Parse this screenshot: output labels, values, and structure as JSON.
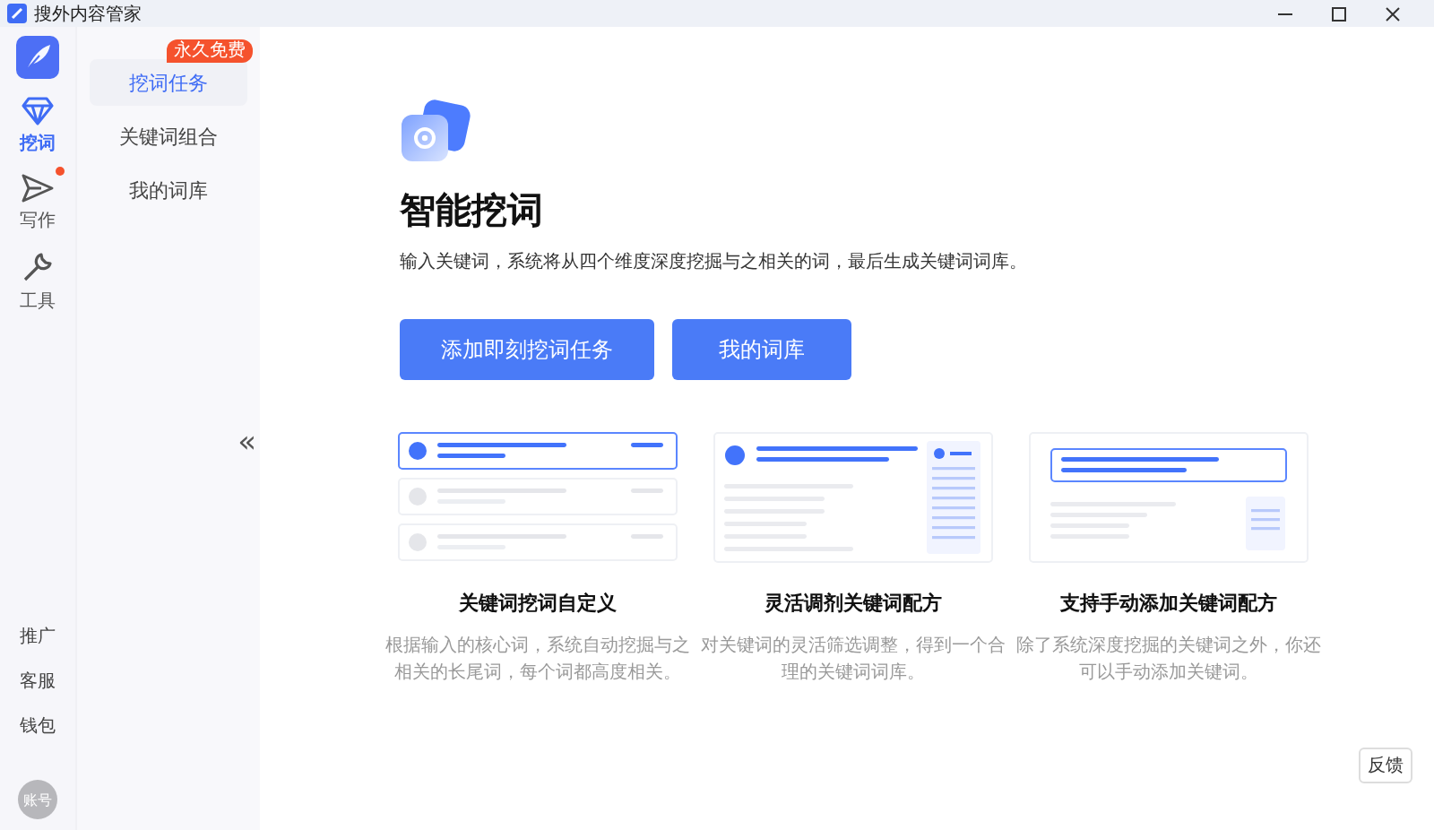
{
  "window": {
    "title": "搜外内容管家"
  },
  "rail": {
    "items": [
      {
        "kind": "diamond",
        "label": "挖词",
        "selected": true,
        "dot": false
      },
      {
        "kind": "send",
        "label": "写作",
        "selected": false,
        "dot": true
      },
      {
        "kind": "wrench",
        "label": "工具",
        "selected": false,
        "dot": false
      }
    ],
    "bottom_links": [
      "推广",
      "客服",
      "钱包"
    ],
    "avatar": "账号"
  },
  "subnav": {
    "items": [
      {
        "label": "挖词任务",
        "selected": true,
        "badge": "永久免费"
      },
      {
        "label": "关键词组合",
        "selected": false
      },
      {
        "label": "我的词库",
        "selected": false
      }
    ],
    "collapse": "«"
  },
  "hero": {
    "title": "智能挖词",
    "description": "输入关键词，系统将从四个维度深度挖掘与之相关的词，最后生成关键词词库。",
    "buttons": [
      "添加即刻挖词任务",
      "我的词库"
    ]
  },
  "features": [
    {
      "kind": "list",
      "title": "关键词挖词自定义",
      "description": "根据输入的核心词，系统自动挖掘与之相关的长尾词，每个词都高度相关。"
    },
    {
      "kind": "filter",
      "title": "灵活调剂关键词配方",
      "description": "对关键词的灵活筛选调整，得到一个合理的关键词词库。"
    },
    {
      "kind": "manual",
      "title": "支持手动添加关键词配方",
      "description": "除了系统深度挖掘的关键词之外，你还可以手动添加关键词。"
    }
  ],
  "feedback": "反馈"
}
